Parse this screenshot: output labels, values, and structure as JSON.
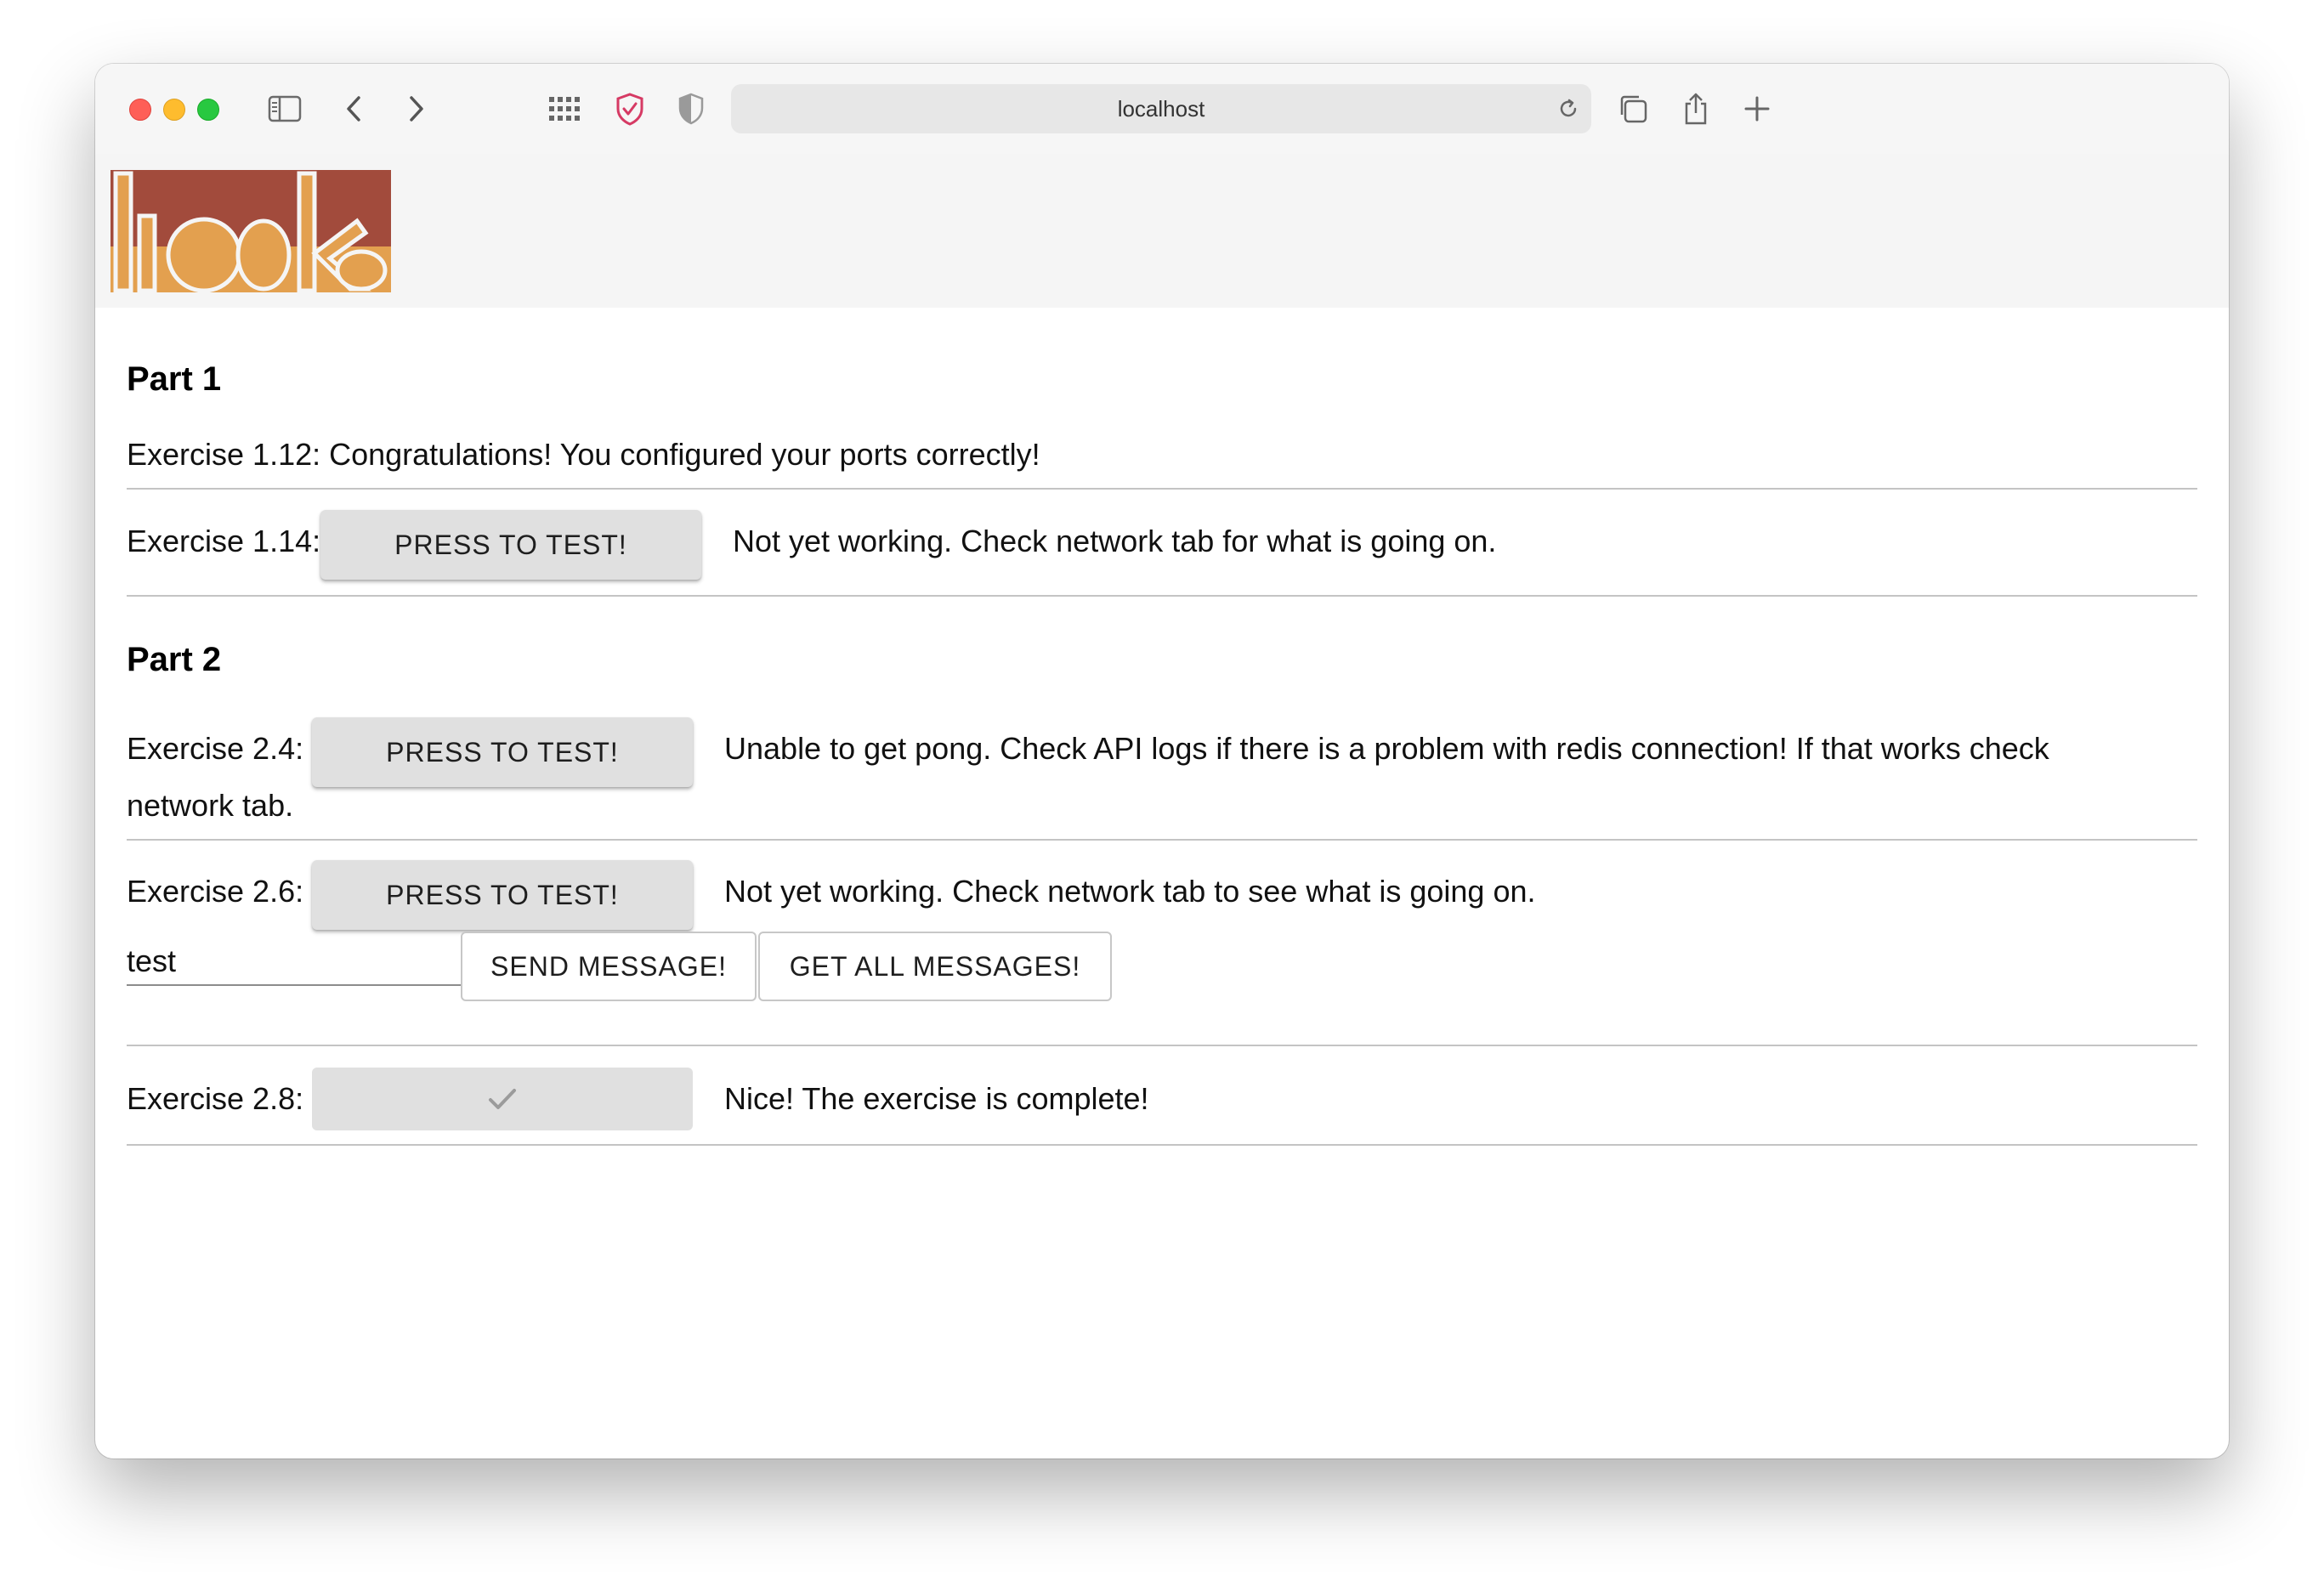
{
  "browser": {
    "url": "localhost",
    "icons": [
      "sidebar-icon",
      "back-icon",
      "forward-icon",
      "grid-icon",
      "shield-check-icon",
      "half-shield-icon",
      "reload-icon",
      "tabs-icon",
      "share-icon",
      "new-tab-icon"
    ]
  },
  "logo": {
    "alt": "toska"
  },
  "colors": {
    "logo_dark": "#a24b3c",
    "logo_light": "#e3a04f",
    "button_bg": "#e0e0e0"
  },
  "part1": {
    "title": "Part 1",
    "ex112": "Exercise 1.12: Congratulations! You configured your ports correctly!",
    "ex114": {
      "label": "Exercise 1.14:",
      "button": "PRESS TO TEST!",
      "status": "Not yet working. Check network tab for what is going on."
    }
  },
  "part2": {
    "title": "Part 2",
    "ex24": {
      "label": "Exercise 2.4:",
      "button": "PRESS TO TEST!",
      "status_line1": "Unable to get pong. Check API logs if there is a problem with redis connection! If that works check",
      "status_line2": "network tab."
    },
    "ex26": {
      "label": "Exercise 2.6:",
      "button": "PRESS TO TEST!",
      "status": "Not yet working. Check network tab to see what is going on.",
      "input_value": "test",
      "send_button": "SEND MESSAGE!",
      "get_button": "GET ALL MESSAGES!"
    },
    "ex28": {
      "label": "Exercise 2.8:",
      "status": "Nice! The exercise is complete!"
    }
  }
}
